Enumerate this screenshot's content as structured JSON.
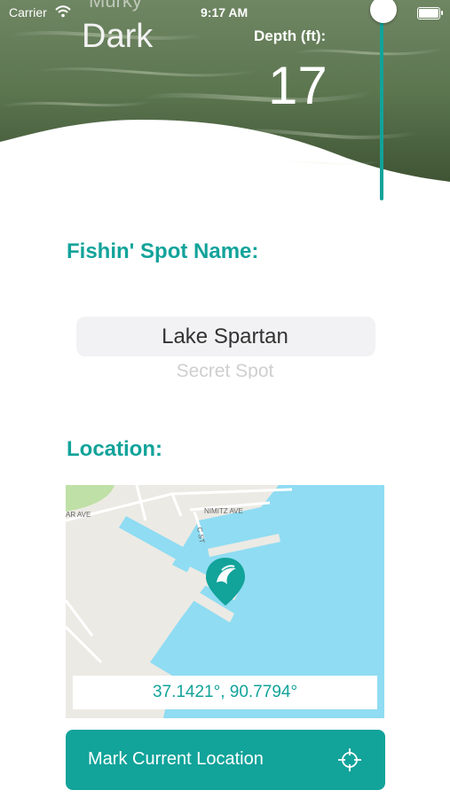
{
  "status_bar": {
    "carrier": "Carrier",
    "time": "9:17 AM"
  },
  "clarity": {
    "previous": "Murky",
    "current": "Dark"
  },
  "depth": {
    "label": "Depth (ft):",
    "value": "17"
  },
  "spot_name": {
    "title": "Fishin' Spot Name:",
    "selected": "Lake Spartan",
    "next": "Secret Spot"
  },
  "location": {
    "title": "Location:",
    "coordinates": "37.1421°, 90.7794°",
    "streets": [
      "AR AVE",
      "NIMITZ AVE",
      "C ST"
    ]
  },
  "actions": {
    "mark_current_location": "Mark Current Location"
  },
  "colors": {
    "accent": "#12a39a",
    "water": "#8fdcf3",
    "land": "#eceae4"
  }
}
